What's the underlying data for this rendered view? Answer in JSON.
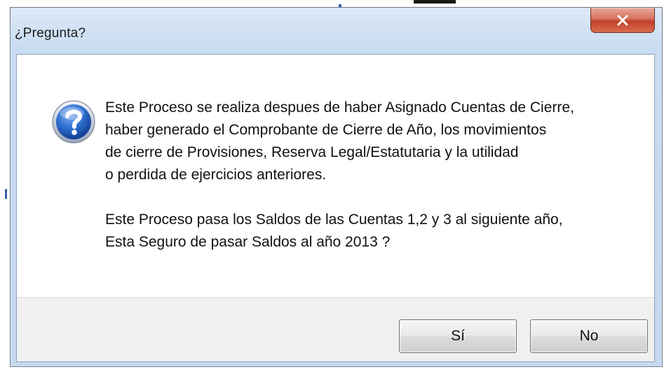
{
  "dialog": {
    "title": "¿Pregunta?",
    "icon": "question-icon",
    "close_icon": "close-icon",
    "message": {
      "paragraph1": [
        "Este Proceso se realiza despues de haber Asignado Cuentas de Cierre,",
        "haber generado el Comprobante de Cierre de Año, los movimientos",
        "de cierre de Provisiones, Reserva Legal/Estatutaria y la utilidad",
        "o perdida de ejercicios anteriores."
      ],
      "paragraph2": [
        "Este Proceso pasa los Saldos de las Cuentas 1,2 y 3 al siguiente año,",
        "Esta Seguro de pasar Saldos al año 2013 ?"
      ]
    },
    "buttons": {
      "yes_label": "Sí",
      "no_label": "No"
    }
  },
  "colors": {
    "close_button": "#c1412a",
    "frame": "#c9dcf1",
    "footer": "#f0f0f0"
  }
}
